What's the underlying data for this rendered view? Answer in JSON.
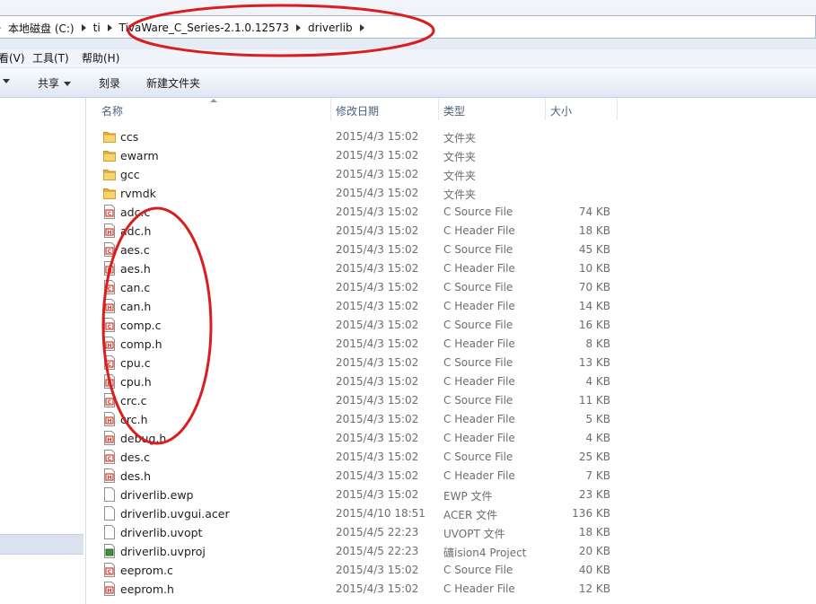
{
  "breadcrumb": [
    "本地磁盘 (C:)",
    "ti",
    "TivaWare_C_Series-2.1.0.12573",
    "driverlib"
  ],
  "menu": [
    "看(V)",
    "工具(T)",
    "帮助(H)"
  ],
  "toolbar": {
    "share": "共享",
    "burn": "刻录",
    "new_folder": "新建文件夹"
  },
  "columns": {
    "name": "名称",
    "date": "修改日期",
    "type": "类型",
    "size": "大小"
  },
  "files": [
    {
      "name": "ccs",
      "date": "2015/4/3 15:02",
      "type": "文件夹",
      "size": "",
      "icon": "folder-icon"
    },
    {
      "name": "ewarm",
      "date": "2015/4/3 15:02",
      "type": "文件夹",
      "size": "",
      "icon": "folder-icon"
    },
    {
      "name": "gcc",
      "date": "2015/4/3 15:02",
      "type": "文件夹",
      "size": "",
      "icon": "folder-icon"
    },
    {
      "name": "rvmdk",
      "date": "2015/4/3 15:02",
      "type": "文件夹",
      "size": "",
      "icon": "folder-icon"
    },
    {
      "name": "adc.c",
      "date": "2015/4/3 15:02",
      "type": "C Source File",
      "size": "74 KB",
      "icon": "c-source-icon"
    },
    {
      "name": "adc.h",
      "date": "2015/4/3 15:02",
      "type": "C Header File",
      "size": "18 KB",
      "icon": "c-header-icon"
    },
    {
      "name": "aes.c",
      "date": "2015/4/3 15:02",
      "type": "C Source File",
      "size": "45 KB",
      "icon": "c-source-icon"
    },
    {
      "name": "aes.h",
      "date": "2015/4/3 15:02",
      "type": "C Header File",
      "size": "10 KB",
      "icon": "c-header-icon"
    },
    {
      "name": "can.c",
      "date": "2015/4/3 15:02",
      "type": "C Source File",
      "size": "70 KB",
      "icon": "c-source-icon"
    },
    {
      "name": "can.h",
      "date": "2015/4/3 15:02",
      "type": "C Header File",
      "size": "14 KB",
      "icon": "c-header-icon"
    },
    {
      "name": "comp.c",
      "date": "2015/4/3 15:02",
      "type": "C Source File",
      "size": "16 KB",
      "icon": "c-source-icon"
    },
    {
      "name": "comp.h",
      "date": "2015/4/3 15:02",
      "type": "C Header File",
      "size": "8 KB",
      "icon": "c-header-icon"
    },
    {
      "name": "cpu.c",
      "date": "2015/4/3 15:02",
      "type": "C Source File",
      "size": "13 KB",
      "icon": "c-source-icon"
    },
    {
      "name": "cpu.h",
      "date": "2015/4/3 15:02",
      "type": "C Header File",
      "size": "4 KB",
      "icon": "c-header-icon"
    },
    {
      "name": "crc.c",
      "date": "2015/4/3 15:02",
      "type": "C Source File",
      "size": "11 KB",
      "icon": "c-source-icon"
    },
    {
      "name": "crc.h",
      "date": "2015/4/3 15:02",
      "type": "C Header File",
      "size": "5 KB",
      "icon": "c-header-icon"
    },
    {
      "name": "debug.h",
      "date": "2015/4/3 15:02",
      "type": "C Header File",
      "size": "4 KB",
      "icon": "c-header-icon"
    },
    {
      "name": "des.c",
      "date": "2015/4/3 15:02",
      "type": "C Source File",
      "size": "25 KB",
      "icon": "c-source-icon"
    },
    {
      "name": "des.h",
      "date": "2015/4/3 15:02",
      "type": "C Header File",
      "size": "7 KB",
      "icon": "c-header-icon"
    },
    {
      "name": "driverlib.ewp",
      "date": "2015/4/3 15:02",
      "type": "EWP 文件",
      "size": "23 KB",
      "icon": "blank-file-icon"
    },
    {
      "name": "driverlib.uvgui.acer",
      "date": "2015/4/10 18:51",
      "type": "ACER 文件",
      "size": "136 KB",
      "icon": "blank-file-icon"
    },
    {
      "name": "driverlib.uvopt",
      "date": "2015/4/5 22:23",
      "type": "UVOPT 文件",
      "size": "18 KB",
      "icon": "blank-file-icon"
    },
    {
      "name": "driverlib.uvproj",
      "date": "2015/4/5 22:23",
      "type": "礦ision4 Project",
      "size": "20 KB",
      "icon": "uvision-project-icon"
    },
    {
      "name": "eeprom.c",
      "date": "2015/4/3 15:02",
      "type": "C Source File",
      "size": "40 KB",
      "icon": "c-source-icon"
    },
    {
      "name": "eeprom.h",
      "date": "2015/4/3 15:02",
      "type": "C Header File",
      "size": "12 KB",
      "icon": "c-header-icon"
    }
  ],
  "colors": {
    "annotation": "#d81e1e",
    "selection": "#d9e2ee",
    "folder": "#f2c64f"
  }
}
